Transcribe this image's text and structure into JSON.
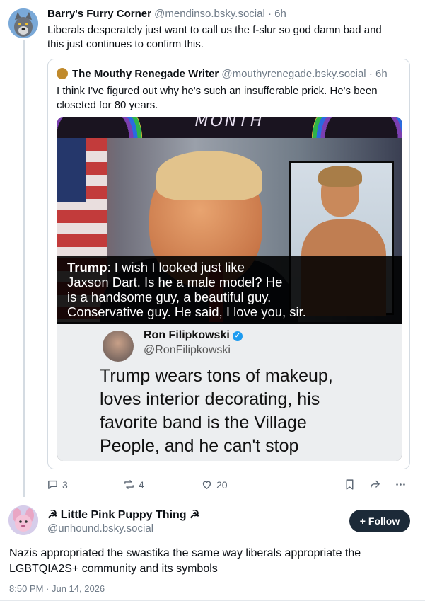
{
  "post1": {
    "display_name": "Barry's Furry Corner",
    "handle": "@mendinso.bsky.social",
    "time": "· 6h",
    "text_line1": "Liberals desperately just want to call us the f-slur so god damn bad and",
    "text_line2": "this just continues to confirm this."
  },
  "quote": {
    "display_name": "The Mouthy Renegade Writer",
    "handle": "@mouthyrenegade.bsky.social",
    "time": "· 6h",
    "text_line1": "I think I've figured out why he's such an insufferable prick. He's been",
    "text_line2": "closeted for 80 years.",
    "image": {
      "banner": "MONTH",
      "caption_speaker": "Trump",
      "caption_line1": ": I wish I looked just like",
      "caption_line2": "Jaxson Dart. Is he a male model? He",
      "caption_line3": "is a handsome guy, a beautiful guy.",
      "caption_line4": "Conservative guy. He said, I love you, sir.",
      "tweet_name": "Ron Filipkowski",
      "tweet_handle": "@RonFilipkowski",
      "tweet_line1": "Trump wears tons of makeup,",
      "tweet_line2": "loves interior decorating, his",
      "tweet_line3": "favorite band is the Village",
      "tweet_line4": "People, and he can't stop"
    }
  },
  "actions": {
    "replies": "3",
    "reposts": "4",
    "likes": "20"
  },
  "post2": {
    "display_name": "☭ Little Pink Puppy Thing ☭",
    "handle": "@unhound.bsky.social",
    "follow_label": "Follow",
    "text_line1": "Nazis appropriated the swastika the same way liberals appropriate the",
    "text_line2": "LGBTQIA2S+ community and its symbols",
    "timestamp": "8:50 PM · Jun 14, 2026"
  },
  "colors": {
    "accent_follow": "#1c2a38",
    "muted_text": "#6f7b88",
    "verified_blue": "#1d9bf0"
  }
}
